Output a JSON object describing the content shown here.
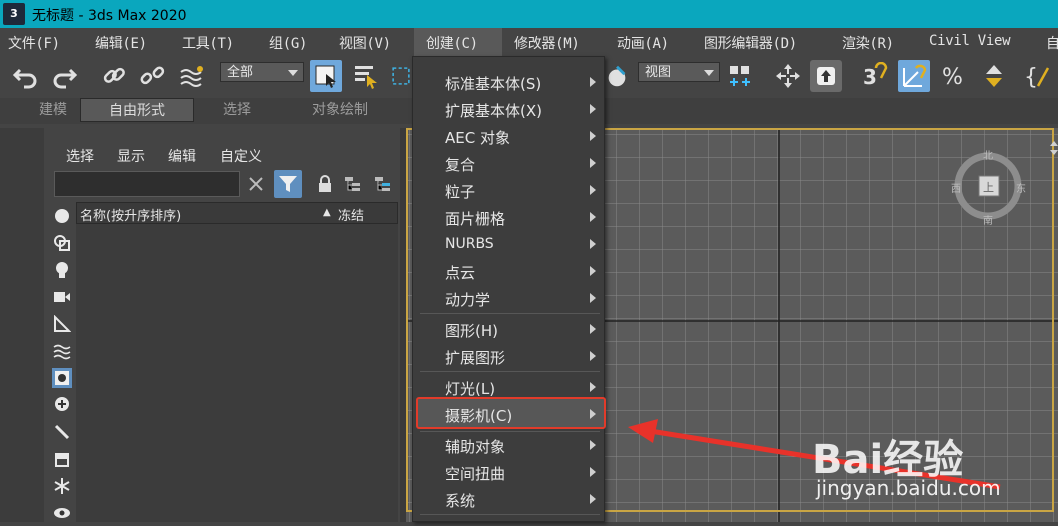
{
  "app": {
    "icon_label": "3",
    "title": "无标题 - 3ds Max 2020"
  },
  "menubar": {
    "items": [
      "文件(F)",
      "编辑(E)",
      "工具(T)",
      "组(G)",
      "视图(V)",
      "创建(C)",
      "修改器(M)",
      "动画(A)",
      "图形编辑器(D)",
      "渲染(R)",
      "Civil View",
      "自"
    ]
  },
  "toolbar": {
    "selection_filter": "全部",
    "ref_coord": "视图"
  },
  "ribbon": {
    "tabs": [
      "建模",
      "自由形式",
      "选择",
      "对象绘制"
    ],
    "active": "自由形式"
  },
  "scene_explorer": {
    "tabs": [
      "选择",
      "显示",
      "编辑",
      "自定义"
    ],
    "columns": [
      "名称(按升序排序)",
      "冻结"
    ],
    "sort_indicator": "▲"
  },
  "viewcube": {
    "north": "北",
    "south": "南",
    "east": "东",
    "west": "西",
    "face": "上"
  },
  "create_menu": {
    "items": [
      {
        "label": "标准基本体(S)",
        "submenu": true
      },
      {
        "label": "扩展基本体(X)",
        "submenu": true
      },
      {
        "label": "AEC 对象",
        "submenu": true
      },
      {
        "label": "复合",
        "submenu": true
      },
      {
        "label": "粒子",
        "submenu": true
      },
      {
        "label": "面片栅格",
        "submenu": true
      },
      {
        "label": "NURBS",
        "submenu": true
      },
      {
        "label": "点云",
        "submenu": true
      },
      {
        "label": "动力学",
        "submenu": true
      },
      {
        "label": "图形(H)",
        "submenu": true
      },
      {
        "label": "扩展图形",
        "submenu": true
      },
      {
        "label": "灯光(L)",
        "submenu": true
      },
      {
        "label": "摄影机(C)",
        "submenu": true,
        "highlighted": true
      },
      {
        "label": "辅助对象",
        "submenu": true
      },
      {
        "label": "空间扭曲",
        "submenu": true
      },
      {
        "label": "系统",
        "submenu": true
      }
    ]
  },
  "annotation": {
    "highlight_color": "#e23b2a",
    "arrow_color": "#e8322a"
  },
  "watermark": {
    "brand": "Bai经验",
    "url": "jingyan.baidu.com"
  },
  "colors": {
    "titlebar": "#0aa7be",
    "viewport_border": "#c9a544",
    "ui_bg": "#444444"
  }
}
